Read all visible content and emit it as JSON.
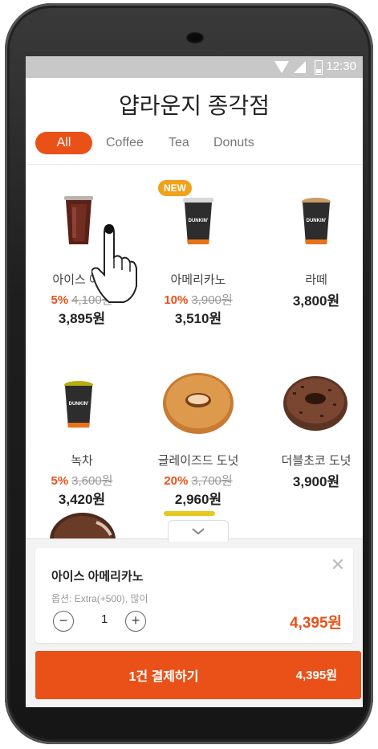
{
  "status": {
    "time": "12:30"
  },
  "store": {
    "title": "얍라운지 종각점"
  },
  "tabs": [
    {
      "label": "All"
    },
    {
      "label": "Coffee"
    },
    {
      "label": "Tea"
    },
    {
      "label": "Donuts"
    }
  ],
  "badge": {
    "new": "NEW"
  },
  "products": [
    {
      "name": "아이스 아메리카노",
      "name_visible": "아이스 아메",
      "discount": "5%",
      "original": "4,100원",
      "price": "3,895원"
    },
    {
      "name": "아메리카노",
      "discount": "10%",
      "original": "3,900원",
      "price": "3,510원"
    },
    {
      "name": "라떼",
      "price": "3,800원"
    },
    {
      "name": "녹차",
      "discount": "5%",
      "original": "3,600원",
      "price": "3,420원"
    },
    {
      "name": "글레이즈드 도넛",
      "discount": "20%",
      "original": "3,700원",
      "price": "2,960원"
    },
    {
      "name": "더블초코 도넛",
      "price": "3,900원"
    }
  ],
  "cart": {
    "item_name": "아이스 아메리카노",
    "options": "옵션: Extra(+500), 많이",
    "quantity": "1",
    "item_price": "4,395원"
  },
  "pay": {
    "label": "1건 결제하기",
    "total": "4,395원"
  },
  "colors": {
    "accent": "#e95119",
    "badge": "#f1a21c"
  },
  "icons": [
    "wifi-icon",
    "signal-icon",
    "battery-icon",
    "close-icon",
    "minus-icon",
    "plus-icon",
    "chevron-down-icon",
    "hand-pointer-icon"
  ]
}
